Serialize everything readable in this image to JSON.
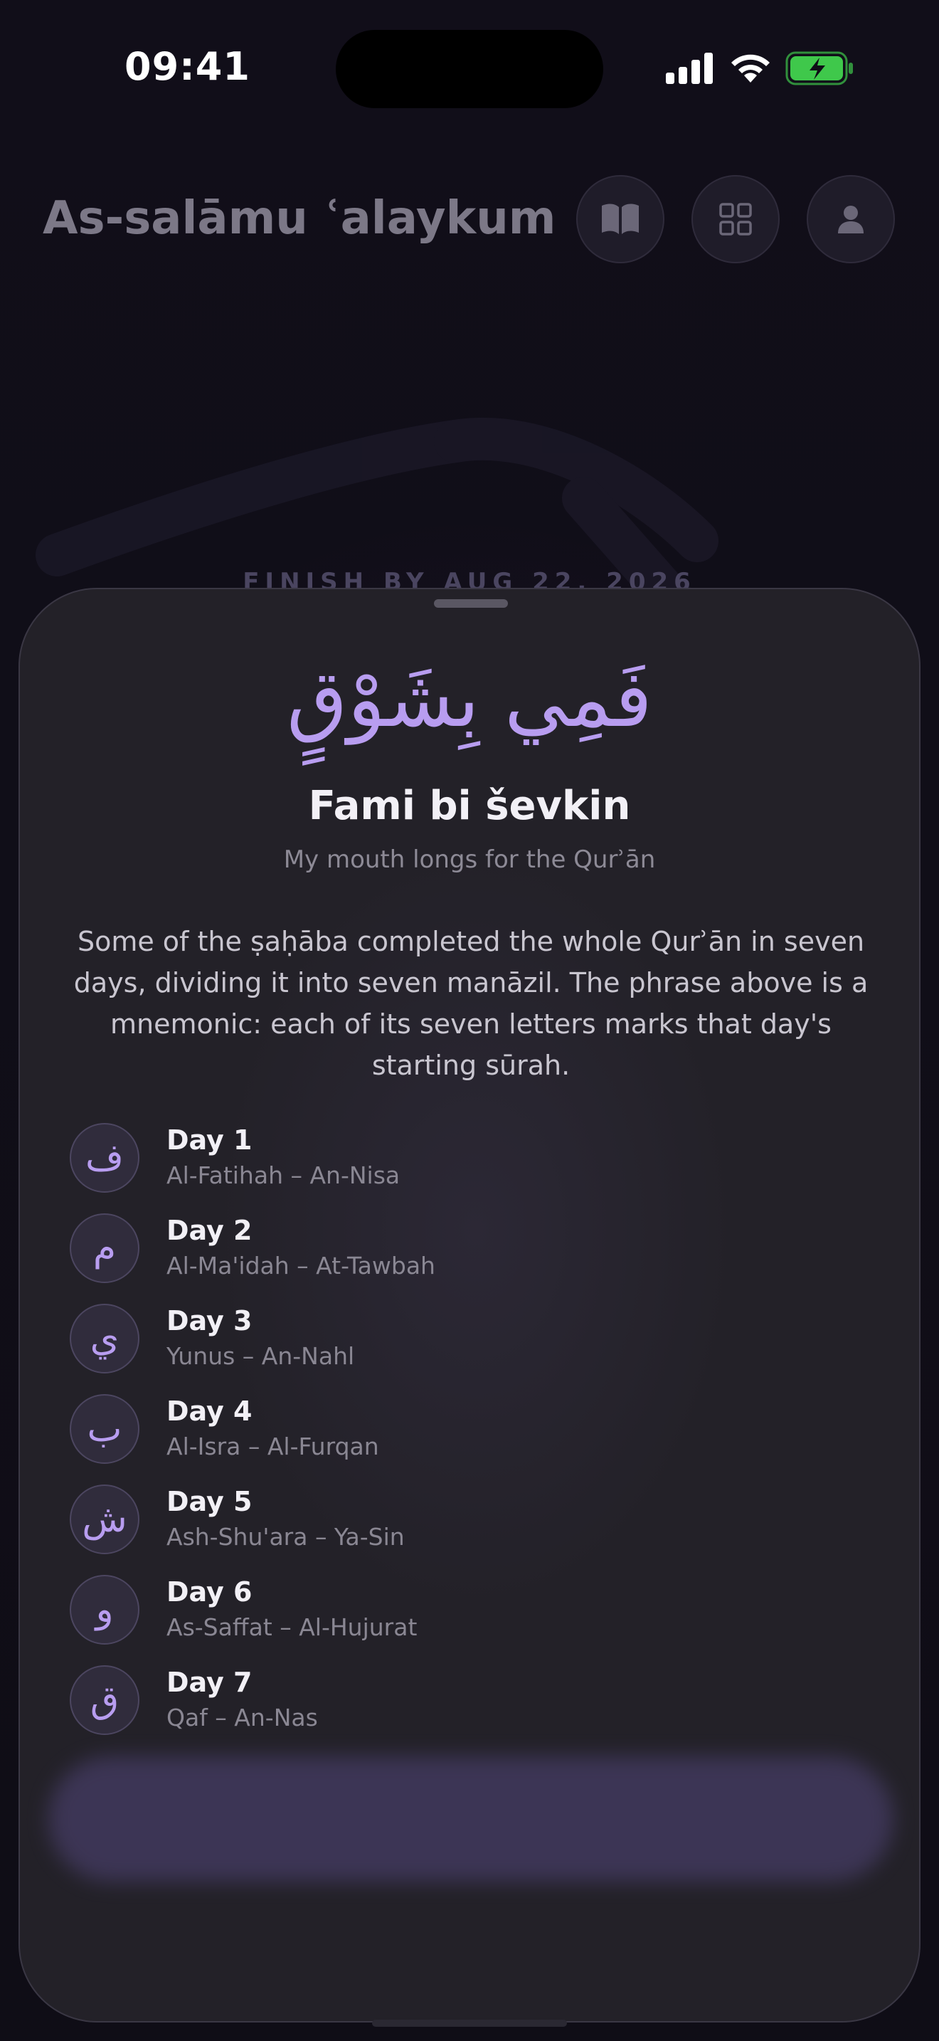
{
  "status_bar": {
    "time": "09:41",
    "icons": [
      "cellular-signal-icon",
      "wifi-icon",
      "battery-charging-icon"
    ],
    "battery_color": "#3fc84b"
  },
  "header": {
    "greeting": "As-salāmu ʿalaykum",
    "buttons": [
      {
        "name": "book-button",
        "icon": "open-book-icon"
      },
      {
        "name": "grid-button",
        "icon": "grid-icon"
      },
      {
        "name": "profile-button",
        "icon": "person-icon"
      }
    ]
  },
  "background": {
    "finish_by": "FINISH BY AUG 22, 2026"
  },
  "sheet": {
    "arabic_phrase": "فَمِي بِشَوْقٍ",
    "title": "Fami bi ševkin",
    "subtitle": "My mouth longs for the Qurʾān",
    "description": "Some of the ṣaḥāba completed the whole Qurʾān in seven days, dividing it into seven manāzil. The phrase above is a mnemonic: each of its seven letters marks that day's starting sūrah.",
    "days": [
      {
        "letter": "ف",
        "label": "Day 1",
        "range": "Al-Fatihah – An-Nisa"
      },
      {
        "letter": "م",
        "label": "Day 2",
        "range": "Al-Ma'idah – At-Tawbah"
      },
      {
        "letter": "ي",
        "label": "Day 3",
        "range": "Yunus – An-Nahl"
      },
      {
        "letter": "ب",
        "label": "Day 4",
        "range": "Al-Isra – Al-Furqan"
      },
      {
        "letter": "ش",
        "label": "Day 5",
        "range": "Ash-Shu'ara – Ya-Sin"
      },
      {
        "letter": "و",
        "label": "Day 6",
        "range": "As-Saffat – Al-Hujurat"
      },
      {
        "letter": "ق",
        "label": "Day 7",
        "range": "Qaf – An-Nas"
      }
    ]
  },
  "colors": {
    "accent": "#b89df0",
    "background": "#0f0d16",
    "sheet": "#232128"
  }
}
